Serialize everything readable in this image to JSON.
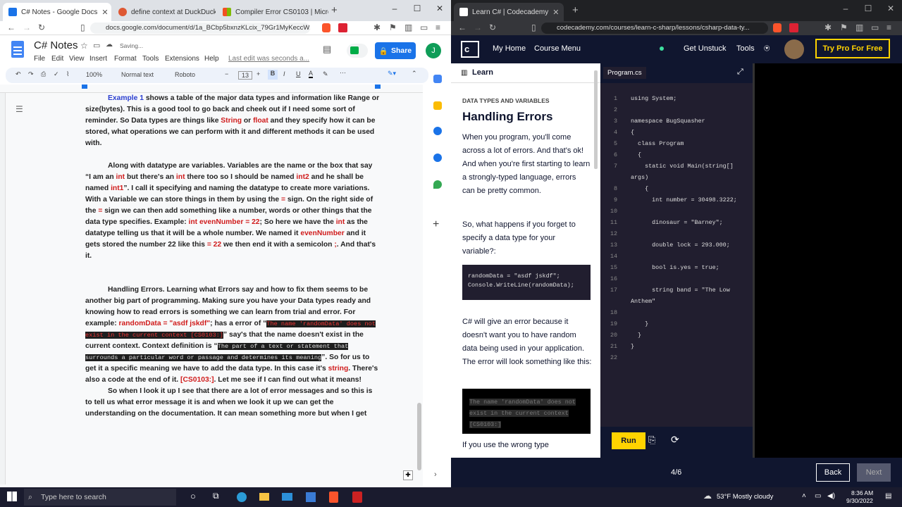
{
  "left_browser": {
    "tabs": [
      {
        "label": "C# Notes - Google Docs",
        "color": "#1a73e8"
      },
      {
        "label": "define context at DuckDuckGo",
        "color": "#de5833"
      },
      {
        "label": "Compiler Error CS0103 | Microsoft L",
        "color": "#00a4ef"
      }
    ],
    "url": "docs.google.com/document/d/1a_BCbp5bxnzKLcix_79Gr1MyKeccW..."
  },
  "docs": {
    "title": "C# Notes",
    "saving": "Saving...",
    "share": "Share",
    "avatar": "J",
    "menu": [
      "File",
      "Edit",
      "View",
      "Insert",
      "Format",
      "Tools",
      "Extensions",
      "Help"
    ],
    "last_edit": "Last edit was seconds a...",
    "zoom": "100%",
    "style": "Normal text",
    "font": "Roboto",
    "font_size": "13"
  },
  "doc_text": {
    "p1": [
      {
        "t": "Example 1",
        "c": "blue"
      },
      {
        "t": " shows a table of the major data types and information like Range or size(bytes). This is a good tool to go back and cheek out if I need some sort of reminder. So Data types are things like "
      },
      {
        "t": "String",
        "c": "red"
      },
      {
        "t": " or "
      },
      {
        "t": "float",
        "c": "red"
      },
      {
        "t": " and they specify how it can be stored, what operations we can perform with it and different methods it can be used with."
      }
    ],
    "p2": [
      {
        "t": "Along with datatype are variables. Variables are the name or the box that say “I am an "
      },
      {
        "t": "int",
        "c": "red"
      },
      {
        "t": " but there's an "
      },
      {
        "t": "int",
        "c": "red"
      },
      {
        "t": " there too so I should be named "
      },
      {
        "t": "int2",
        "c": "red"
      },
      {
        "t": " and he shall be named "
      },
      {
        "t": "int1",
        "c": "red"
      },
      {
        "t": "”. I call it specifying and naming the datatype to create more variations. With a Variable we can store things in them by using the "
      },
      {
        "t": "=",
        "c": "red"
      },
      {
        "t": " sign. On the right side of the "
      },
      {
        "t": "=",
        "c": "red"
      },
      {
        "t": " sign we can then add something like a number, words or other things that the data type specifies. Example: "
      },
      {
        "t": "int evenNumber = 22",
        "c": "red"
      },
      {
        "t": "; So here we have the "
      },
      {
        "t": "int",
        "c": "red"
      },
      {
        "t": " as the datatype telling us that it will be a whole number. We named it "
      },
      {
        "t": "evenNumber",
        "c": "red"
      },
      {
        "t": " and it gets stored the number 22 like this "
      },
      {
        "t": "= 22",
        "c": "red"
      },
      {
        "t": " we then end it with a semicolon "
      },
      {
        "t": ";",
        "c": "red"
      },
      {
        "t": ". And that's it."
      }
    ],
    "p3": [
      {
        "t": "Handling Errors. Learning what Errors say and how to fix them seems to be another big part of programming. Making sure you have your Data types ready and knowing how to read errors is something we can learn from trial and error. For example: "
      },
      {
        "t": "randomData = \"asdf jskdf\"",
        "c": "red"
      },
      {
        "t": "; has a error of “"
      },
      {
        "t": "The name 'randomData' does not exist in the current context [CS0103:]",
        "c": "hlred"
      },
      {
        "t": "” say's that the name doesn't exist in the current context. Context definition is “"
      },
      {
        "t": "The part of a text or statement that surrounds a particular word or passage and determines its meaning",
        "c": "hl"
      },
      {
        "t": "”. So for us to get it a specific meaning we have to add the data type. In this case it's "
      },
      {
        "t": "string",
        "c": "red"
      },
      {
        "t": ". There's also a code at the end of it. "
      },
      {
        "t": "[CS0103:]",
        "c": "red"
      },
      {
        "t": ". Let me see if I can find out what it means!"
      }
    ],
    "p4": [
      {
        "t": "So when I look it up I see that there are a lot of error messages and so this is to tell us what error message it is and when we look it up we can get the understanding on the documentation. It can mean something more but when I get"
      }
    ]
  },
  "right_browser": {
    "tab": "Learn C# | Codecademy",
    "url": "codecademy.com/courses/learn-c-sharp/lessons/csharp-data-ty..."
  },
  "codecademy": {
    "nav": [
      "My Home",
      "Course Menu"
    ],
    "get_unstuck": "Get Unstuck",
    "tools": "Tools",
    "try_pro": "Try Pro For Free",
    "learn_tab": "Learn",
    "section": "DATA TYPES AND VARIABLES",
    "heading": "Handling Errors",
    "para1": "When you program, you'll come across a lot of errors. And that's ok! And when you're first starting to learn a strongly-typed language, errors can be pretty common.",
    "para2": "So, what happens if you forget to specify a data type for your variable?:",
    "snippet": [
      "randomData = \"asdf jskdf\";",
      "Console.WriteLine(randomData);"
    ],
    "para3": "C# will give an error because it doesn't want you to have random data being used in your application. The error will look something like this:",
    "error_block": "The name 'randomData' does not exist in the current context [CS0103:]",
    "para4": "If you use the wrong type",
    "file_tab": "Program.cs",
    "code_lines": [
      {
        "n": "1",
        "code": "using System;"
      },
      {
        "n": "2",
        "code": ""
      },
      {
        "n": "3",
        "code": "namespace BugSquasher"
      },
      {
        "n": "4",
        "code": "{"
      },
      {
        "n": "5",
        "code": "  class Program"
      },
      {
        "n": "6",
        "code": "  {"
      },
      {
        "n": "7",
        "code": "    static void Main(string[]"
      },
      {
        "n": "",
        "code": "args)"
      },
      {
        "n": "8",
        "code": "    {"
      },
      {
        "n": "9",
        "code": "      int number = 30498.3222;"
      },
      {
        "n": "10",
        "code": ""
      },
      {
        "n": "11",
        "code": "      dinosaur = \"Barney\";"
      },
      {
        "n": "12",
        "code": ""
      },
      {
        "n": "13",
        "code": "      double lock = 293.000;"
      },
      {
        "n": "14",
        "code": ""
      },
      {
        "n": "15",
        "code": "      bool is.yes = true;"
      },
      {
        "n": "16",
        "code": ""
      },
      {
        "n": "17",
        "code": "      string band = \"The Low"
      },
      {
        "n": "",
        "code": "Anthem\""
      },
      {
        "n": "18",
        "code": ""
      },
      {
        "n": "19",
        "code": "    }"
      },
      {
        "n": "20",
        "code": "  }"
      },
      {
        "n": "21",
        "code": "}"
      },
      {
        "n": "22",
        "code": ""
      }
    ],
    "run": "Run",
    "progress": "4/6",
    "back": "Back",
    "next": "Next"
  },
  "taskbar": {
    "search": "Type here to search",
    "weather": "53°F  Mostly cloudy",
    "time": "8:36 AM",
    "date": "9/30/2022"
  }
}
